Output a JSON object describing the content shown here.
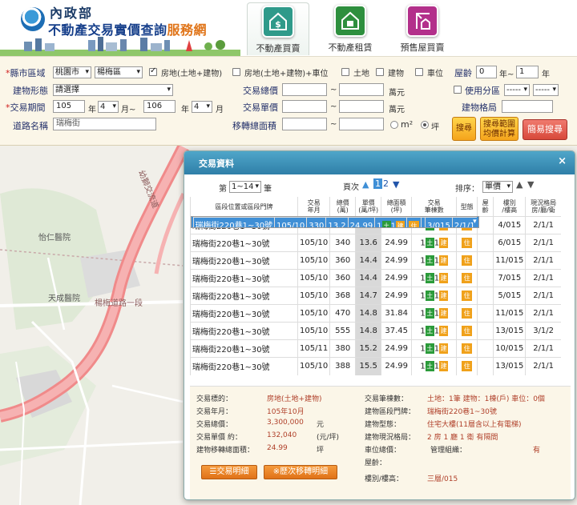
{
  "header": {
    "agency": "內政部",
    "title_main": "不動產交易實價查詢",
    "title_accent": "服務網",
    "nav": [
      {
        "label": "不動產買賣",
        "icon": "house-dollar-icon"
      },
      {
        "label": "不動產租賃",
        "icon": "house-rent-icon"
      },
      {
        "label": "預售屋買賣",
        "icon": "crane-building-icon"
      }
    ]
  },
  "search": {
    "county_label": "縣市區域",
    "county": "桃園市",
    "district": "楊梅區",
    "opt_house": "房地(土地+建物)",
    "opt_house_parking": "房地(土地+建物)+車位",
    "opt_land": "土地",
    "opt_building": "建物",
    "opt_parking": "車位",
    "age_label": "屋齡",
    "age_from": "0",
    "age_sep": "年~",
    "age_to": "1",
    "age_unit": "年",
    "type_label": "建物形態",
    "type_value": "請選擇",
    "total_label": "交易總價",
    "total_unit": "萬元",
    "zoning_label": "使用分區",
    "zoning_a": "-----",
    "zoning_b": "-----",
    "period_label": "交易期間",
    "year_from": "105",
    "month_from": "4",
    "year_to": "106",
    "month_to": "4",
    "year_unit": "年",
    "month_unit_tilde": "月~",
    "month_unit": "月",
    "unit_label": "交易單價",
    "unit_unit": "萬元",
    "layout_label": "建物格局",
    "road_label": "道路名稱",
    "road_value": "瑞梅街",
    "area_label": "移轉總面積",
    "area_unit_m2": "m²",
    "area_unit_ping": "坪",
    "tilde": "~",
    "btn_search": "搜尋",
    "btn_range": "搜尋範圍\n均價計算",
    "btn_simple": "簡易搜尋"
  },
  "map": {
    "label_hospital1": "怡仁醫院",
    "label_hospital2": "天成醫院",
    "label_road1": "幼獅交流道",
    "label_road2": "楊梅道路一段"
  },
  "dialog": {
    "title": "交易資料",
    "close": "×",
    "page_prefix": "第",
    "page_range": "1~14",
    "page_suffix": "筆",
    "page_label": "頁次",
    "page_current": "1",
    "page_next": "2",
    "sort_label": "排序：",
    "sort_value": "單價",
    "columns": [
      "區段位置或區段門牌",
      "交易\n年月",
      "總價\n(萬)",
      "單價\n(萬/坪)",
      "總面積\n(坪)",
      "交易\n筆棟數",
      "型態",
      "屋\n齡",
      "樓別\n/樓高",
      "現況格局\n房/廳/衛"
    ],
    "rows": [
      {
        "addr": "瑞梅街220巷1~30號",
        "ym": "105/10",
        "total": "330",
        "unit": "13.2",
        "area": "24.99",
        "n_land": "1",
        "n_bldg": "1",
        "type": "住",
        "age": "",
        "floor": "3/015",
        "layout": "2/1/1"
      },
      {
        "addr": "瑞梅街220巷1~30號",
        "ym": "105/10",
        "total": "338",
        "unit": "13.5",
        "area": "24.99",
        "n_land": "1",
        "n_bldg": "1",
        "type": "住",
        "age": "",
        "floor": "4/015",
        "layout": "2/1/1"
      },
      {
        "addr": "瑞梅街220巷1~30號",
        "ym": "105/10",
        "total": "340",
        "unit": "13.6",
        "area": "24.99",
        "n_land": "1",
        "n_bldg": "1",
        "type": "住",
        "age": "",
        "floor": "6/015",
        "layout": "2/1/1"
      },
      {
        "addr": "瑞梅街220巷1~30號",
        "ym": "105/10",
        "total": "360",
        "unit": "14.4",
        "area": "24.99",
        "n_land": "1",
        "n_bldg": "1",
        "type": "住",
        "age": "",
        "floor": "11/015",
        "layout": "2/1/1"
      },
      {
        "addr": "瑞梅街220巷1~30號",
        "ym": "105/10",
        "total": "360",
        "unit": "14.4",
        "area": "24.99",
        "n_land": "1",
        "n_bldg": "1",
        "type": "住",
        "age": "",
        "floor": "7/015",
        "layout": "2/1/1"
      },
      {
        "addr": "瑞梅街220巷1~30號",
        "ym": "105/10",
        "total": "368",
        "unit": "14.7",
        "area": "24.99",
        "n_land": "1",
        "n_bldg": "1",
        "type": "住",
        "age": "",
        "floor": "5/015",
        "layout": "2/1/1"
      },
      {
        "addr": "瑞梅街220巷1~30號",
        "ym": "105/10",
        "total": "470",
        "unit": "14.8",
        "area": "31.84",
        "n_land": "1",
        "n_bldg": "1",
        "type": "住",
        "age": "",
        "floor": "11/015",
        "layout": "2/1/1"
      },
      {
        "addr": "瑞梅街220巷1~30號",
        "ym": "105/10",
        "total": "555",
        "unit": "14.8",
        "area": "37.45",
        "n_land": "1",
        "n_bldg": "1",
        "type": "住",
        "age": "",
        "floor": "13/015",
        "layout": "3/1/2"
      },
      {
        "addr": "瑞梅街220巷1~30號",
        "ym": "105/11",
        "total": "380",
        "unit": "15.2",
        "area": "24.99",
        "n_land": "1",
        "n_bldg": "1",
        "type": "住",
        "age": "",
        "floor": "10/015",
        "layout": "2/1/1"
      },
      {
        "addr": "瑞梅街220巷1~30號",
        "ym": "105/10",
        "total": "388",
        "unit": "15.5",
        "area": "24.99",
        "n_land": "1",
        "n_bldg": "1",
        "type": "住",
        "age": "",
        "floor": "13/015",
        "layout": "2/1/1"
      }
    ],
    "detail": {
      "target_label": "交易標的：",
      "target_value": "房地(土地+建物)",
      "ym_label": "交易年月：",
      "ym_value": "105年10月",
      "total_label": "交易總價：",
      "total_value": "3,300,000",
      "total_unit": "元",
      "unit_label": "交易單價 約：",
      "unit_value": "132,040",
      "unit_unit": "(元/坪)",
      "area_label": "建物移轉總面積：",
      "area_value": "24.99",
      "area_unit": "坪",
      "count_label": "交易筆棟數：",
      "count_value": "土地：1筆 建物：1棟(戶) 車位：0個",
      "addr_label": "建物區段門牌：",
      "addr_value": "瑞梅街220巷1~30號",
      "bldg_type_label": "建物型態：",
      "bldg_type_value": "住宅大樓(11層含以上有電梯)",
      "layout_label": "建物現況格局：",
      "layout_value": "2 房 1 廳 1 衛 有隔間",
      "parking_label": "車位總價：",
      "mgmt_label": "管理組織：",
      "mgmt_value": "有",
      "age_label": "屋齡：",
      "floor_label": "樓別/樓高：",
      "floor_value": "三層/015",
      "btn_detail": "交易明細",
      "btn_history": "※歷次移轉明細"
    }
  },
  "colors": {
    "accent_blue": "#3f8fd6",
    "header_teal": "#2f7fa8",
    "orange": "#f0a11a",
    "land_green": "#2b9b3a",
    "map_road": "#f08a8a"
  }
}
